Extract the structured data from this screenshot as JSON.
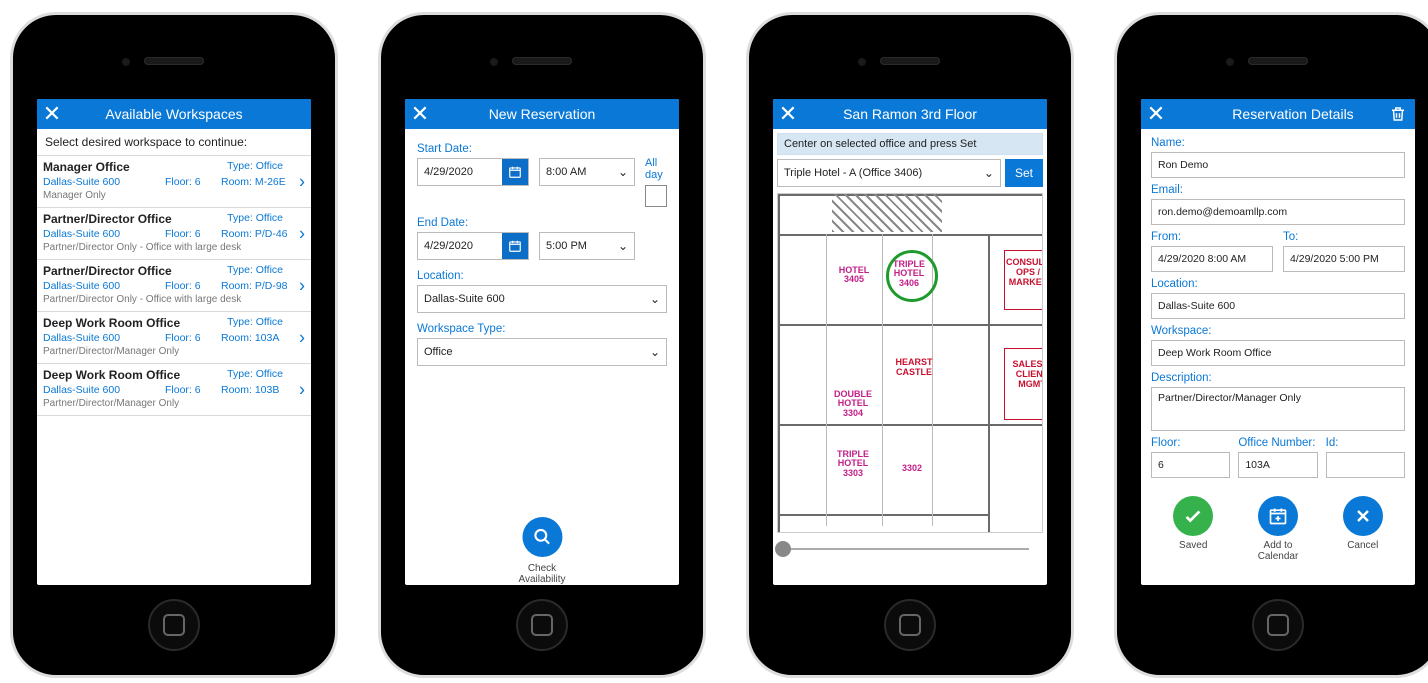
{
  "screen1": {
    "title": "Available Workspaces",
    "instruction": "Select desired workspace to continue:",
    "type_label": "Type: Office",
    "floor_label": "Floor: 6",
    "items": [
      {
        "title": "Manager Office",
        "location": "Dallas-Suite 600",
        "room": "Room: M-26E",
        "meta": "Manager Only"
      },
      {
        "title": "Partner/Director Office",
        "location": "Dallas-Suite 600",
        "room": "Room: P/D-46",
        "meta": "Partner/Director Only - Office with large desk"
      },
      {
        "title": "Partner/Director Office",
        "location": "Dallas-Suite 600",
        "room": "Room: P/D-98",
        "meta": "Partner/Director Only - Office with large desk"
      },
      {
        "title": "Deep Work Room Office",
        "location": "Dallas-Suite 600",
        "room": "Room: 103A",
        "meta": "Partner/Director/Manager Only"
      },
      {
        "title": "Deep Work Room Office",
        "location": "Dallas-Suite 600",
        "room": "Room: 103B",
        "meta": "Partner/Director/Manager Only"
      }
    ]
  },
  "screen2": {
    "title": "New Reservation",
    "start_label": "Start Date:",
    "end_label": "End Date:",
    "allday_label": "All day",
    "start_date": "4/29/2020",
    "start_time": "8:00 AM",
    "end_date": "4/29/2020",
    "end_time": "5:00 PM",
    "location_label": "Location:",
    "location_value": "Dallas-Suite 600",
    "type_label": "Workspace Type:",
    "type_value": "Office",
    "check_label": "Check\nAvailability"
  },
  "screen3": {
    "title": "San Ramon 3rd Floor",
    "hint": "Center on selected office and press Set",
    "select_value": "Triple Hotel - A (Office 3406)",
    "set_label": "Set",
    "h1": "HOTEL",
    "h1n": "3405",
    "h2": "TRIPLE HOTEL",
    "h2n": "3406",
    "r1": "CONSULTING OPS / MARKET",
    "r2": "SALES & CLIENT MGMT",
    "hc": "HEARST CASTLE",
    "dh": "DOUBLE HOTEL",
    "dhn": "3304",
    "th": "TRIPLE HOTEL",
    "thn": "3303",
    "n3302": "3302"
  },
  "screen4": {
    "title": "Reservation Details",
    "name_label": "Name:",
    "name": "Ron Demo",
    "email_label": "Email:",
    "email": "ron.demo@demoamllp.com",
    "from_label": "From:",
    "from": "4/29/2020 8:00 AM",
    "to_label": "To:",
    "to": "4/29/2020 5:00 PM",
    "location_label": "Location:",
    "location": "Dallas-Suite 600",
    "workspace_label": "Workspace:",
    "workspace": "Deep Work Room Office",
    "desc_label": "Description:",
    "desc": "Partner/Director/Manager Only",
    "floor_label": "Floor:",
    "floor": "6",
    "office_label": "Office Number:",
    "office": "103A",
    "id_label": "Id:",
    "id": "",
    "saved": "Saved",
    "addcal": "Add to\nCalendar",
    "cancel": "Cancel"
  }
}
